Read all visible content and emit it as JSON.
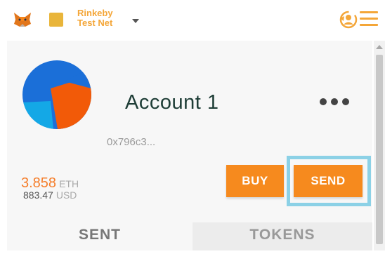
{
  "header": {
    "network_line1": "Rinkeby",
    "network_line2": "Test Net",
    "icons": [
      "metamask-fox-icon",
      "network-indicator-icon",
      "chevron-down-icon",
      "account-switch-icon",
      "hamburger-menu-icon"
    ]
  },
  "account": {
    "name": "Account 1",
    "address": "0x796c3...",
    "balance_eth": "3.858",
    "eth_unit": "ETH",
    "balance_usd": "883.47",
    "usd_unit": "USD"
  },
  "actions": {
    "buy_label": "BUY",
    "send_label": "SEND"
  },
  "tabs": [
    {
      "label": "SENT",
      "active": true
    },
    {
      "label": "TOKENS",
      "active": false
    }
  ],
  "colors": {
    "accent": "#f68a1e",
    "network": "#e9b53a",
    "highlight": "#8cd1e6",
    "account_name": "#1e3d36"
  }
}
